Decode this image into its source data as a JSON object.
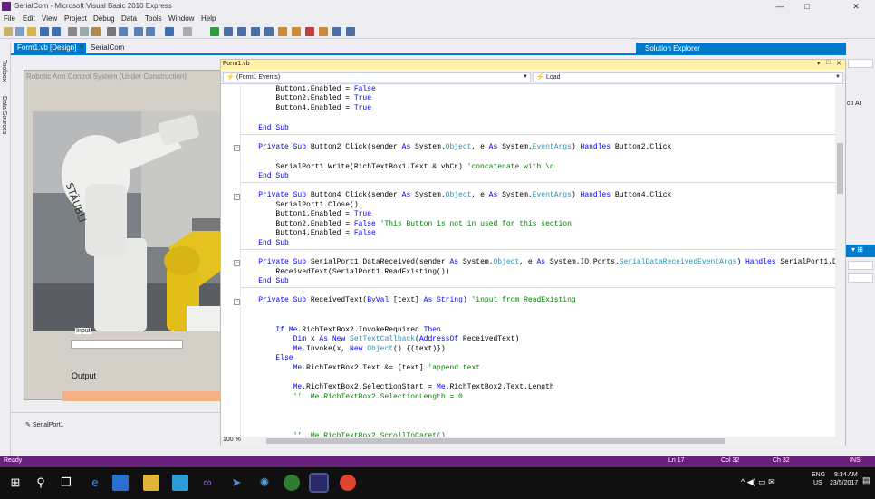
{
  "window": {
    "title": "SerialCom - Microsoft Visual Basic 2010 Express",
    "controls": {
      "minimize": "—",
      "restore": "□",
      "close": "✕"
    }
  },
  "menu": [
    "File",
    "Edit",
    "View",
    "Project",
    "Debug",
    "Data",
    "Tools",
    "Window",
    "Help"
  ],
  "side_tabs": [
    "Toolbox",
    "Data Sources"
  ],
  "doc_tabs": [
    {
      "label": "Form1.vb [Design]",
      "close": "✕",
      "active": true
    },
    {
      "label": "SerialCom",
      "active": false
    }
  ],
  "designer": {
    "form_title": "Robotic Arm Control System (Under Construction)",
    "input_label": "Input",
    "output_label": "Output",
    "tray_item": "SerialPort1"
  },
  "code_window": {
    "title": "Form1.vb",
    "class_dropdown": "(Form1 Events)",
    "method_dropdown": "Load",
    "zoom": "100 %"
  },
  "solution_explorer": {
    "title": "Solution Explorer",
    "fragment": "co Ar"
  },
  "status": {
    "ready": "Ready",
    "ln": "Ln 17",
    "col": "Col 32",
    "ch": "Ch 32",
    "ins": "INS"
  },
  "taskbar": {
    "lang": "ENG",
    "region": "US",
    "time": "8:34 AM",
    "date": "23/5/2017"
  },
  "colors": {
    "vs_purple": "#68217a",
    "accent_blue": "#007acc",
    "output_box": "#f4b183"
  }
}
